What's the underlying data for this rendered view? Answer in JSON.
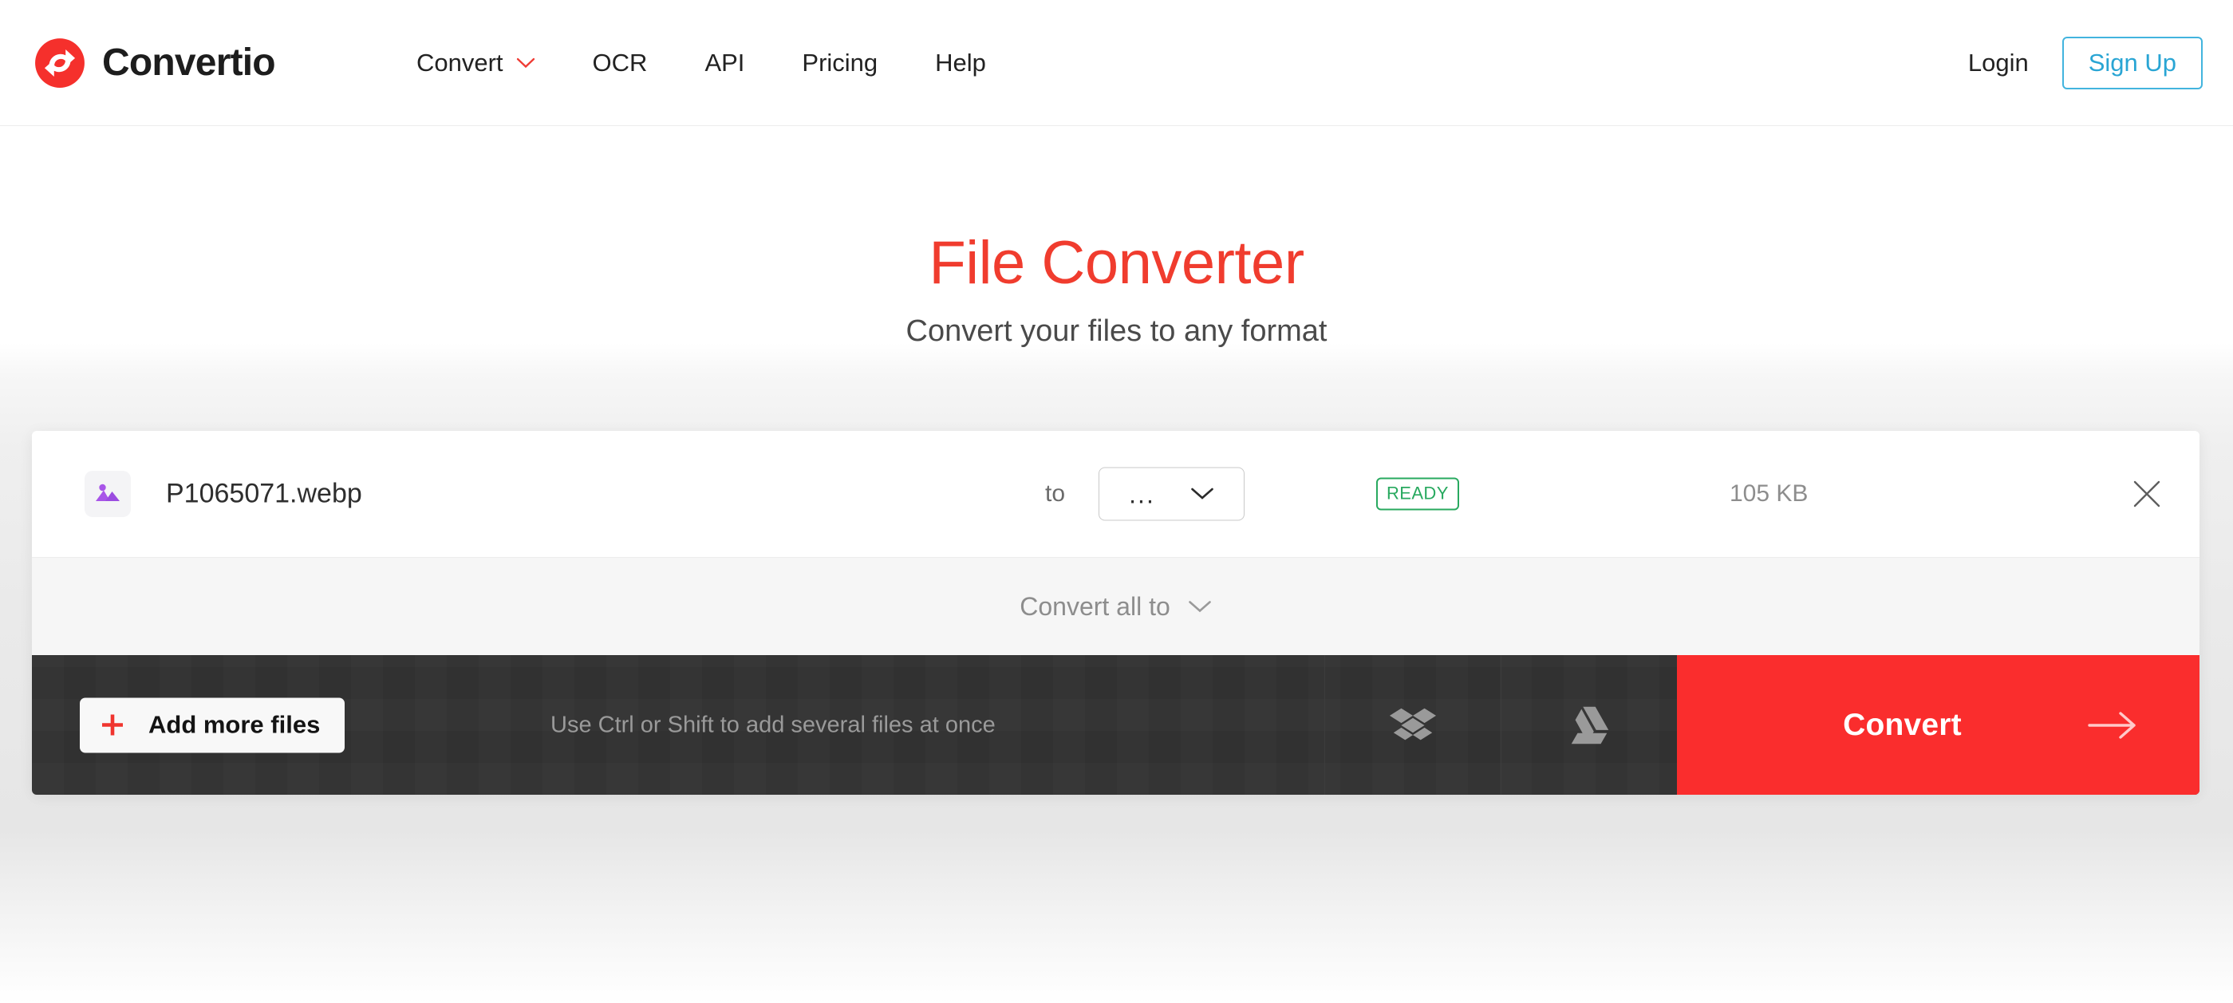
{
  "header": {
    "brand_name": "Convertio",
    "logo_icon": "convertio-logo-icon",
    "nav": [
      {
        "label": "Convert",
        "has_chevron": true,
        "icon": "chevron-down-icon"
      },
      {
        "label": "OCR",
        "has_chevron": false
      },
      {
        "label": "API",
        "has_chevron": false
      },
      {
        "label": "Pricing",
        "has_chevron": false
      },
      {
        "label": "Help",
        "has_chevron": false
      }
    ],
    "login_label": "Login",
    "signup_label": "Sign Up"
  },
  "hero": {
    "title": "File Converter",
    "subtitle": "Convert your files to any format"
  },
  "file_row": {
    "file_icon": "image-file-icon",
    "file_name": "P1065071.webp",
    "to_label": "to",
    "format_value": "...",
    "format_chevron_icon": "chevron-down-icon",
    "status": "READY",
    "file_size": "105 KB",
    "remove_icon": "close-icon"
  },
  "convert_all": {
    "label": "Convert all to",
    "chevron_icon": "chevron-down-icon"
  },
  "action_bar": {
    "add_more_label": "Add more files",
    "add_more_icon": "plus-icon",
    "hint": "Use Ctrl or Shift to add several files at once",
    "dropbox_icon": "dropbox-icon",
    "google_drive_icon": "google-drive-icon",
    "convert_label": "Convert",
    "convert_arrow_icon": "arrow-right-icon"
  },
  "colors": {
    "brand_red": "#f03c2e",
    "convert_red": "#fa2d2d",
    "signup_blue": "#29a5d4",
    "ready_green": "#28a95f",
    "bar_dark": "#333333",
    "file_icon_purple": "#a855e8"
  }
}
